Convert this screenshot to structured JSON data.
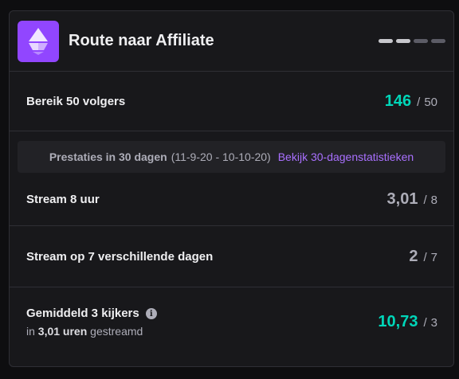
{
  "header": {
    "title": "Route naar Affiliate",
    "progress_steps": [
      {
        "state": "done",
        "color": "#c7c7cc"
      },
      {
        "state": "done",
        "color": "#c7c7cc"
      },
      {
        "state": "todo",
        "color": "#5c5c66"
      },
      {
        "state": "todo",
        "color": "#5c5c66"
      }
    ]
  },
  "followers": {
    "label": "Bereik 50 volgers",
    "current": "146",
    "separator": "/",
    "goal": "50",
    "status_color": "#00d6b9"
  },
  "stats_band": {
    "label": "Prestaties in 30 dagen",
    "range": "(11-9-20 - 10-10-20)",
    "link": "Bekijk 30-dagenstatistieken"
  },
  "requirements": [
    {
      "label": "Stream 8 uur",
      "current": "3,01",
      "separator": "/",
      "goal": "8",
      "met": false
    },
    {
      "label": "Stream op 7 verschillende dagen",
      "current": "2",
      "separator": "/",
      "goal": "7",
      "met": false
    }
  ],
  "viewers": {
    "label": "Gemiddeld 3 kijkers",
    "sub_prefix": "in",
    "sub_value": "3,01 uren",
    "sub_suffix": "gestreamd",
    "current": "10,73",
    "separator": "/",
    "goal": "3",
    "met": true
  },
  "colors": {
    "accent": "#9146ff",
    "link": "#a970ff",
    "met": "#00d6b9",
    "unmet": "#adadb8"
  }
}
